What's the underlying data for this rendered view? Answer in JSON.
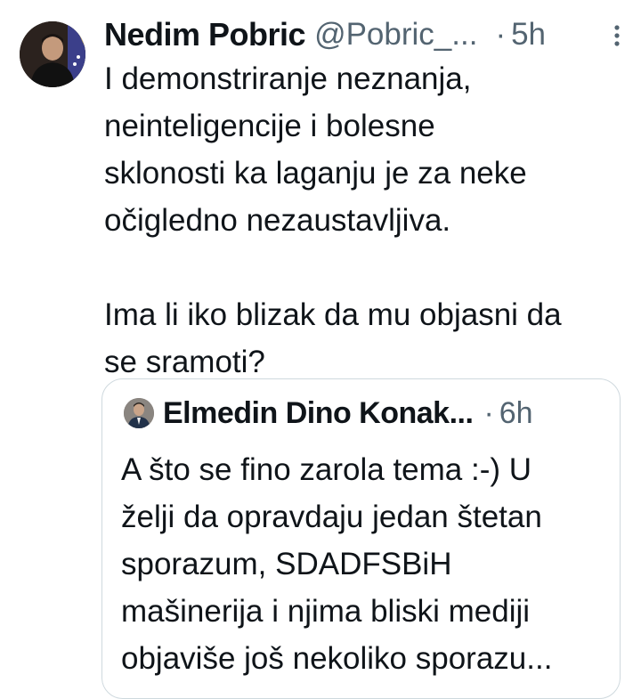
{
  "tweet": {
    "author_name": "Nedim Pobric",
    "author_handle": "@Pobric_...",
    "separator": "·",
    "time": "5h",
    "more_icon": "more-vertical-icon",
    "text": "I demonstriranje neznanja,\nneinteligencije i bolesne\nsklonosti ka laganju je za neke\nočigledno nezaustavljiva.\n\nIma li iko blizak da mu objasni da\nse sramoti?"
  },
  "quoted_tweet": {
    "author_name": "Elmedin Dino Konak...",
    "separator": "·",
    "time": "6h",
    "lines": [
      "A što se fino zarola tema :-) U",
      "želji da opravdaju jedan štetan",
      "sporazum, SDADFSBiH",
      "mašinerija i njima bliski mediji",
      "objaviše još nekoliko sporazu..."
    ]
  },
  "colors": {
    "text_primary": "#0f1419",
    "text_secondary": "#536471",
    "border": "#cfd9de"
  }
}
